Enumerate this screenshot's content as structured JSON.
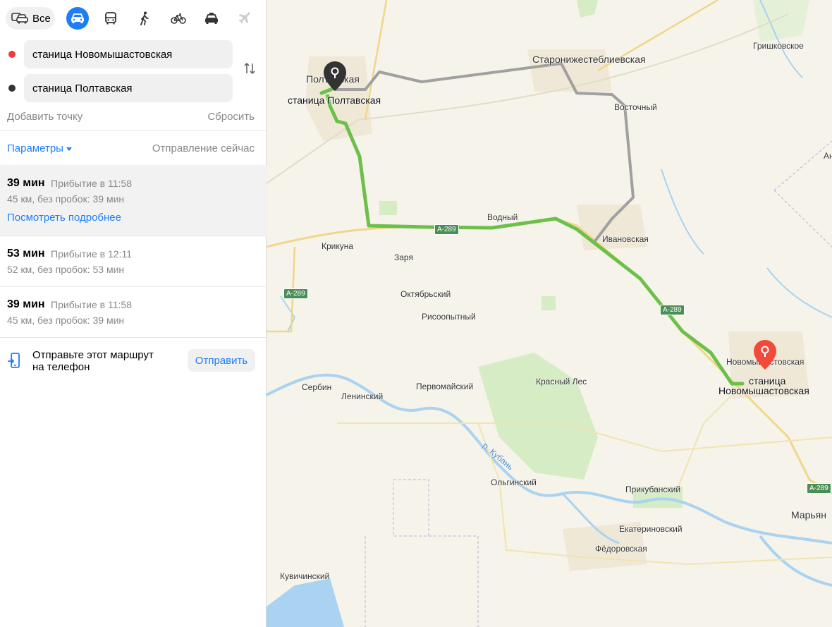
{
  "modes": {
    "all_label": "Все",
    "items": [
      {
        "name": "car",
        "icon": "car-icon",
        "active": true
      },
      {
        "name": "bus",
        "icon": "bus-icon"
      },
      {
        "name": "walk",
        "icon": "walk-icon"
      },
      {
        "name": "bike",
        "icon": "bike-icon"
      },
      {
        "name": "taxi",
        "icon": "taxi-icon"
      },
      {
        "name": "plane",
        "icon": "plane-icon",
        "disabled": true
      }
    ]
  },
  "points": {
    "from": {
      "value": "станица Новомышастовская",
      "dot_color": "#f33a3a"
    },
    "to": {
      "value": "станица Полтавская",
      "dot_color": "#333333"
    }
  },
  "actions": {
    "add_point": "Добавить точку",
    "reset": "Сбросить"
  },
  "settings": {
    "params_label": "Параметры",
    "departure": "Отправление сейчас"
  },
  "routes": [
    {
      "time": "39 мин",
      "arrival": "Прибытие в 11:58",
      "details": "45 км, без пробок: 39 мин",
      "more": "Посмотреть подробнее",
      "selected": true
    },
    {
      "time": "53 мин",
      "arrival": "Прибытие в 12:11",
      "details": "52 км, без пробок: 53 мин"
    },
    {
      "time": "39 мин",
      "arrival": "Прибытие в 11:58",
      "details": "45 км, без пробок: 39 мин"
    }
  ],
  "send": {
    "text": "Отправьте этот маршрут на телефон",
    "button": "Отправить"
  },
  "map": {
    "colors": {
      "route_main": "#6cc04a",
      "route_alt": "#a0a0a0",
      "water": "#a9d3f0",
      "forest": "#d6ecc4",
      "pin_start": "#333333",
      "pin_end": "#f24a3a"
    },
    "labels": [
      {
        "text": "Гришковское"
      },
      {
        "text": "Старонижестеблиевская"
      },
      {
        "text": "Полтавская"
      },
      {
        "text": "станица Полтавская"
      },
      {
        "text": "Восточный"
      },
      {
        "text": "Водный"
      },
      {
        "text": "Ивановская"
      },
      {
        "text": "Крикуна"
      },
      {
        "text": "Заря"
      },
      {
        "text": "Октябрьский"
      },
      {
        "text": "Рисоопытный"
      },
      {
        "text": "Новомышастовская"
      },
      {
        "text": "станица"
      },
      {
        "text": "Новомышастовская"
      },
      {
        "text": "Сербин"
      },
      {
        "text": "Ленинский"
      },
      {
        "text": "Первомайский"
      },
      {
        "text": "Красный Лес"
      },
      {
        "text": "р. Кубань"
      },
      {
        "text": "Ольгинский"
      },
      {
        "text": "Прикубанский"
      },
      {
        "text": "Екатериновский"
      },
      {
        "text": "Фёдоровская"
      },
      {
        "text": "Кувичинский"
      },
      {
        "text": "Марьян"
      },
      {
        "text": "Ан"
      }
    ],
    "shields": [
      "А-289",
      "А-289",
      "А-289",
      "А-289"
    ]
  }
}
